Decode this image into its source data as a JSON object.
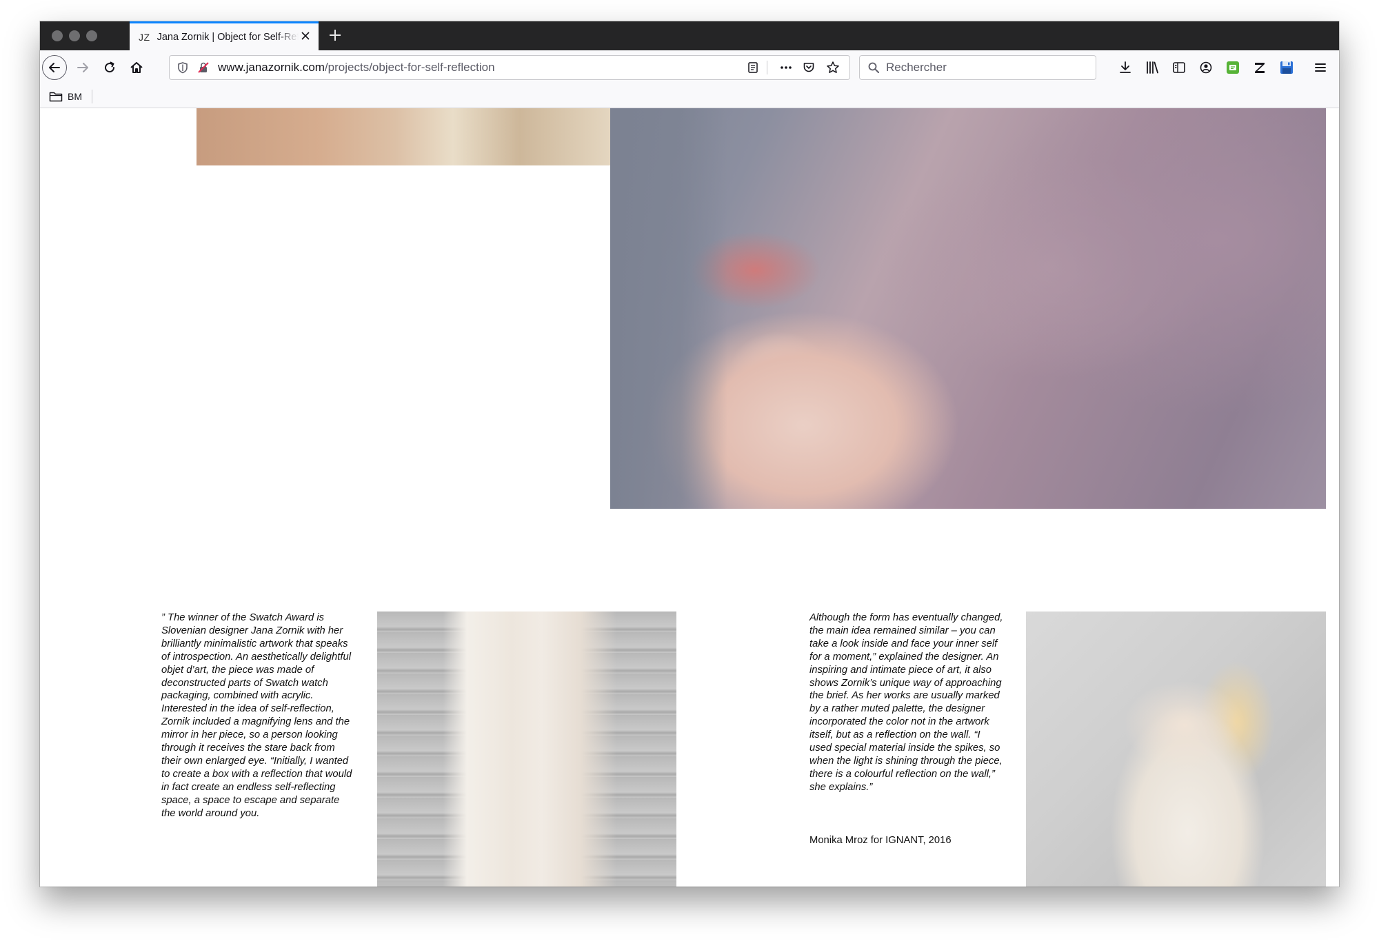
{
  "browser": {
    "tab": {
      "favicon": "JZ",
      "title": "Jana Zornik | Object for Self-Reflection"
    },
    "url": {
      "domain": "www.janazornik.com",
      "path": "/projects/object-for-self-reflection"
    },
    "search": {
      "placeholder": "Rechercher"
    },
    "bookmarks": [
      {
        "label": "BM",
        "icon": "folder-icon"
      }
    ]
  },
  "article": {
    "paragraph_1": "” The winner of the Swatch Award is Slovenian designer Jana Zornik with her brilliantly minimalistic artwork that speaks of introspection. An aesthetically delightful objet d’art, the piece was made of deconstructed parts of Swatch watch packaging, combined with acrylic. Interested in the idea of self-reflection, Zornik included a magnifying lens and the mirror in her piece, so a person looking through it receives the stare back from their own enlarged eye. “Initially, I wanted to create a box with a reflection that would in fact create an endless self-reflecting space, a space to escape and separate the world around you.",
    "paragraph_2": "Although the form has eventually changed, the main idea remained similar – you can take a look inside and face your inner self for a moment,” explained the designer. An inspiring and intimate piece of art, it also shows Zornik’s unique way of approaching the brief. As her works are usually marked by a rather muted palette, the designer incorporated the color not in the artwork itself, but as a reflection on the wall. “I used special material inside the spikes, so when the light is shining through the piece, there is a colourful reflection on the wall,” she explains.”",
    "credit": "Monika Mroz for IGNANT, 2016"
  }
}
